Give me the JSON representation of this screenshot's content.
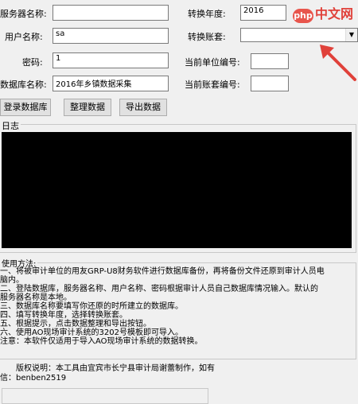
{
  "form": {
    "server_label": "服务器名称:",
    "server_value": "",
    "user_label": "用户名称:",
    "user_value": "sa",
    "password_label": "密码:",
    "password_value": "1",
    "db_label": "数据库名称:",
    "db_value": "2016年乡镇数据采集",
    "year_label": "转换年度:",
    "year_value": "2016",
    "account_label": "转换账套:",
    "account_value": "",
    "unit_label": "当前单位编号:",
    "unit_value": "",
    "acct_no_label": "当前账套编号:",
    "acct_no_value": ""
  },
  "buttons": {
    "login": "登录数据库",
    "organize": "整理数据",
    "export": "导出数据"
  },
  "log": {
    "title": "日志"
  },
  "usage": {
    "title": "使用方法:",
    "lines": [
      "一、将被审计单位的用友GRP-U8财务软件进行数据库备份，再将备份文件还原到审计人员电",
      "脑内。",
      "二、登陆数据库，服务器名称、用户名称、密码根据审计人员自己数据库情况输入。默认的",
      "服务器名称是本地。",
      "三、数据库名称要填写你还原的时所建立的数据库。",
      "四、填写转换年度，选择转换账套。",
      "五、根据提示，点击数据整理和导出按钮。",
      "六、使用AO现场审计系统的3202号模板即可导入。",
      "注意：本软件仅适用于导入AO现场审计系统的数据转换。"
    ],
    "copyright": "版权说明：本工具由宜宾市长宁县审计局谢蕾制作，如有",
    "qq": "信：benben2519"
  },
  "watermark": {
    "logo": "php",
    "text": "中文网"
  },
  "colors": {
    "log_bg": "#000000",
    "arrow": "#e0413a"
  }
}
